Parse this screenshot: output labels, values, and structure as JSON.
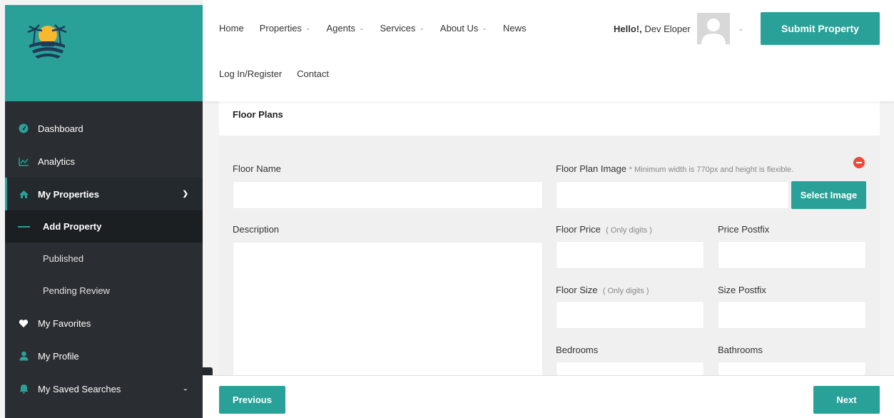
{
  "header": {
    "nav": [
      {
        "label": "Home",
        "dropdown": false
      },
      {
        "label": "Properties",
        "dropdown": true
      },
      {
        "label": "Agents",
        "dropdown": true
      },
      {
        "label": "Services",
        "dropdown": true
      },
      {
        "label": "About Us",
        "dropdown": true
      },
      {
        "label": "News",
        "dropdown": false
      }
    ],
    "nav2": [
      {
        "label": "Log In/Register"
      },
      {
        "label": "Contact"
      }
    ],
    "greeting_prefix": "Hello!,",
    "user_name": "Dev Eloper",
    "submit_label": "Submit Property"
  },
  "sidebar": {
    "items": [
      {
        "label": "Dashboard",
        "icon": "dashboard-icon"
      },
      {
        "label": "Analytics",
        "icon": "chart-line-icon"
      },
      {
        "label": "My Properties",
        "icon": "home-icon"
      },
      {
        "label": "Add Property"
      },
      {
        "label": "Published"
      },
      {
        "label": "Pending Review"
      },
      {
        "label": "My Favorites",
        "icon": "heart-icon"
      },
      {
        "label": "My Profile",
        "icon": "user-icon"
      },
      {
        "label": "My Saved Searches",
        "icon": "bell-icon"
      }
    ]
  },
  "section": {
    "title": "Floor Plans"
  },
  "form": {
    "floor_name_label": "Floor Name",
    "floor_plan_image_label": "Floor Plan Image",
    "floor_plan_image_hint": "* Minimum width is 770px and height is flexible.",
    "select_image_label": "Select Image",
    "description_label": "Description",
    "floor_price_label": "Floor Price",
    "floor_price_hint": "( Only digits )",
    "price_postfix_label": "Price Postfix",
    "floor_size_label": "Floor Size",
    "floor_size_hint": "( Only digits )",
    "size_postfix_label": "Size Postfix",
    "bedrooms_label": "Bedrooms",
    "bathrooms_label": "Bathrooms"
  },
  "footer": {
    "previous_label": "Previous",
    "next_label": "Next"
  },
  "colors": {
    "accent": "#2aa198",
    "sidebar_bg": "#2a2d31",
    "danger": "#e74c3c"
  }
}
